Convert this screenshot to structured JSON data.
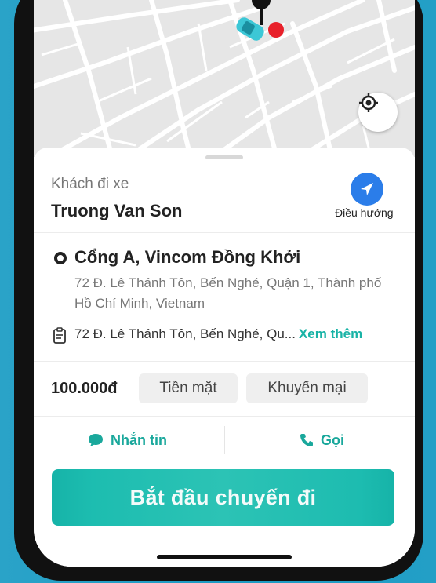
{
  "map": {
    "locate_icon": "crosshair-icon",
    "car_icon": "car-icon",
    "destination_icon": "red-dot-icon"
  },
  "passenger": {
    "label": "Khách đi xe",
    "name": "Truong Van Son"
  },
  "navigation": {
    "label": "Điều hướng",
    "icon": "navigation-arrow-icon",
    "color": "#2b7de9"
  },
  "pickup": {
    "name": "Cổng A, Vincom Đồng Khởi",
    "address": "72 Đ. Lê Thánh Tôn, Bến Nghé, Quận 1, Thành phố Hồ Chí Minh, Vietnam"
  },
  "note": {
    "text": "72 Đ. Lê Thánh Tôn, Bến Nghé, Qu...",
    "more_label": "Xem thêm"
  },
  "fare": {
    "amount": "100.000đ",
    "payment_method": "Tiền mặt",
    "promo_label": "Khuyến mại"
  },
  "actions": {
    "message_label": "Nhắn tin",
    "call_label": "Gọi",
    "accent": "#1aa89c"
  },
  "start_button": {
    "label": "Bắt đầu chuyến đi",
    "color": "#1dbdb0"
  }
}
